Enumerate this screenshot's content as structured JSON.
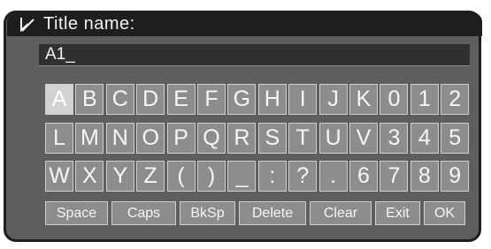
{
  "title": {
    "icon": "edit-icon",
    "label": "Title name:"
  },
  "input": {
    "value": "A1_"
  },
  "keyboard": {
    "selected": "A",
    "rows": [
      [
        "A",
        "B",
        "C",
        "D",
        "E",
        "F",
        "G",
        "H",
        "I",
        "J",
        "K",
        "0",
        "1",
        "2"
      ],
      [
        "L",
        "M",
        "N",
        "O",
        "P",
        "Q",
        "R",
        "S",
        "T",
        "U",
        "V",
        "3",
        "4",
        "5"
      ],
      [
        "W",
        "X",
        "Y",
        "Z",
        "(",
        ")",
        "_",
        ":",
        "?",
        ".",
        "6",
        "7",
        "8",
        "9"
      ]
    ],
    "function_keys": [
      "Space",
      "Caps",
      "BkSp",
      "Delete",
      "Clear",
      "Exit",
      "OK"
    ]
  }
}
